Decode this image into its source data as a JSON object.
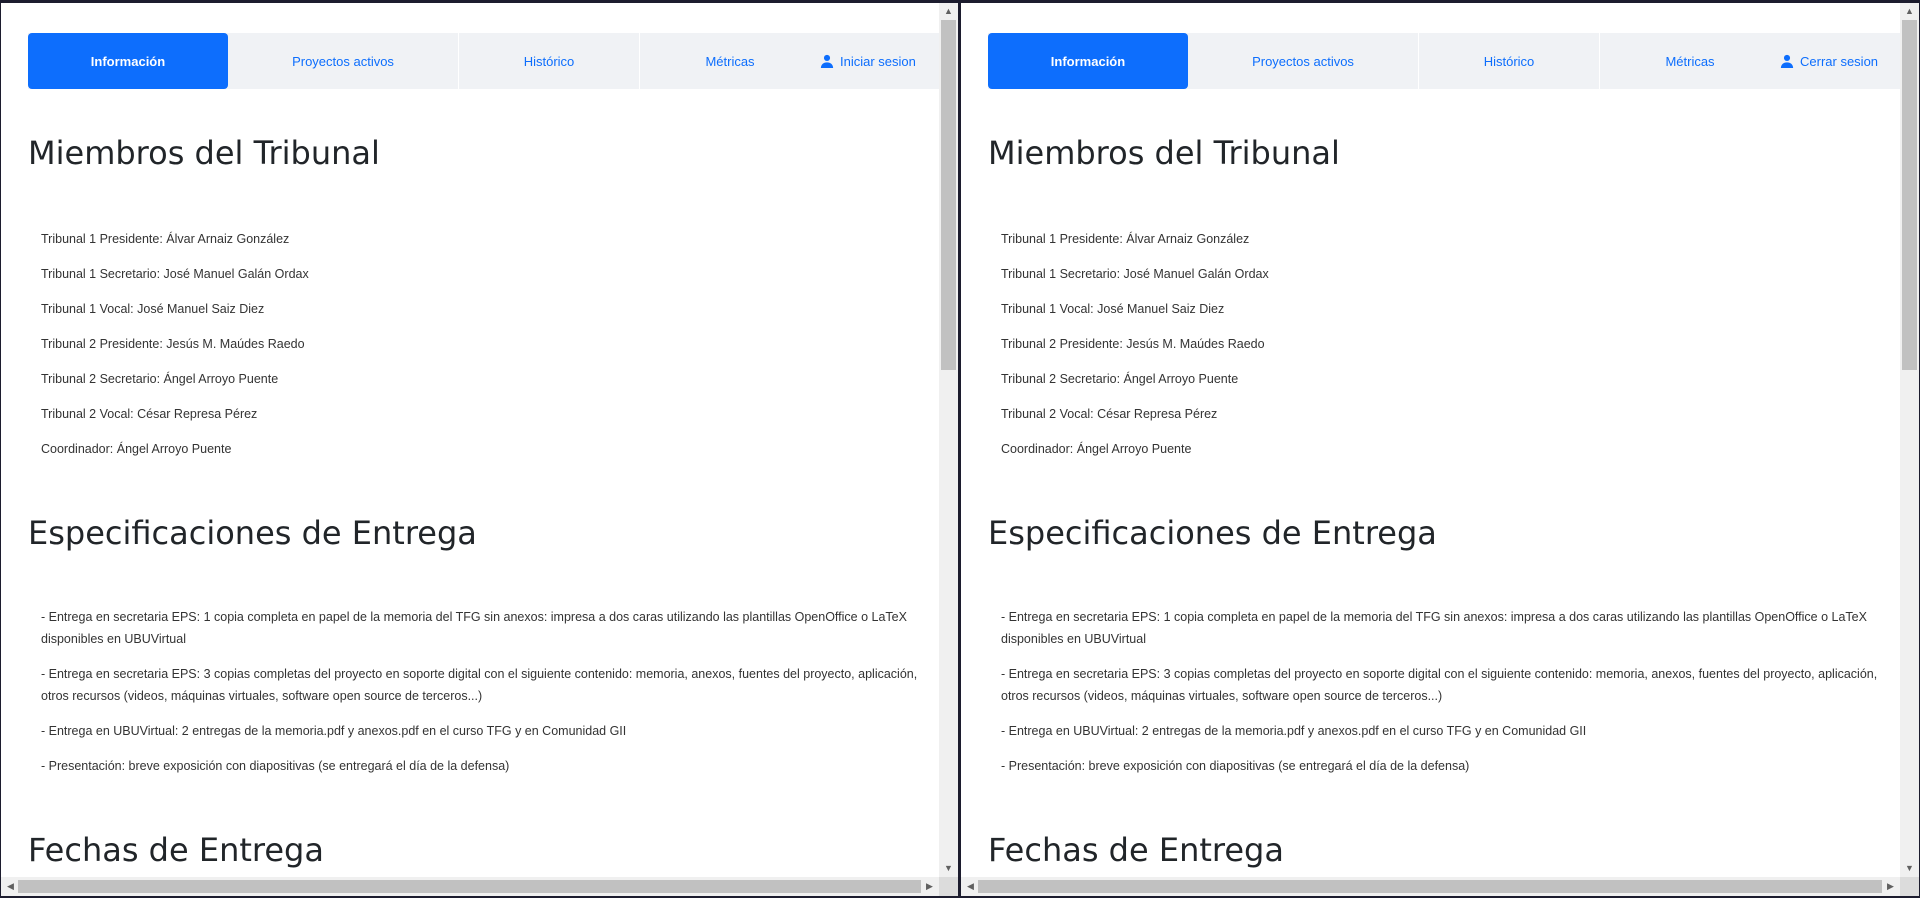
{
  "colors": {
    "accent": "#0d6efd",
    "nav_bg": "#f0f2f5",
    "text": "#212529"
  },
  "panes": [
    {
      "nav": {
        "items": [
          "Información",
          "Proyectos activos",
          "Histórico",
          "Métricas"
        ],
        "auth_icon": "user-icon",
        "auth_label": "Iniciar sesion"
      }
    },
    {
      "nav": {
        "items": [
          "Información",
          "Proyectos activos",
          "Histórico",
          "Métricas"
        ],
        "auth_icon": "user-icon",
        "auth_label": "Cerrar sesion"
      }
    }
  ],
  "sections": {
    "tribunal": {
      "title": "Miembros del Tribunal",
      "items": [
        "Tribunal 1 Presidente: Álvar Arnaiz González",
        "Tribunal 1 Secretario: José Manuel Galán Ordax",
        "Tribunal 1 Vocal: José Manuel Saiz Diez",
        "Tribunal 2 Presidente: Jesús M. Maúdes Raedo",
        "Tribunal 2 Secretario: Ángel Arroyo Puente",
        "Tribunal 2 Vocal: César Represa Pérez",
        "Coordinador: Ángel Arroyo Puente"
      ]
    },
    "especificaciones": {
      "title": "Especificaciones de Entrega",
      "items": [
        "- Entrega en secretaria EPS: 1 copia completa en papel de la memoria del TFG sin anexos: impresa a dos caras utilizando las plantillas OpenOffice o LaTeX disponibles en UBUVirtual",
        "- Entrega en secretaria EPS: 3 copias completas del proyecto en soporte digital con el siguiente contenido: memoria, anexos, fuentes del proyecto, aplicación, otros recursos (videos, máquinas virtuales, software open source de terceros...)",
        "- Entrega en UBUVirtual: 2 entregas de la memoria.pdf y anexos.pdf en el curso TFG y en Comunidad GII",
        "- Presentación: breve exposición con diapositivas (se entregará el día de la defensa)"
      ]
    },
    "fechas": {
      "title": "Fechas de Entrega"
    }
  }
}
